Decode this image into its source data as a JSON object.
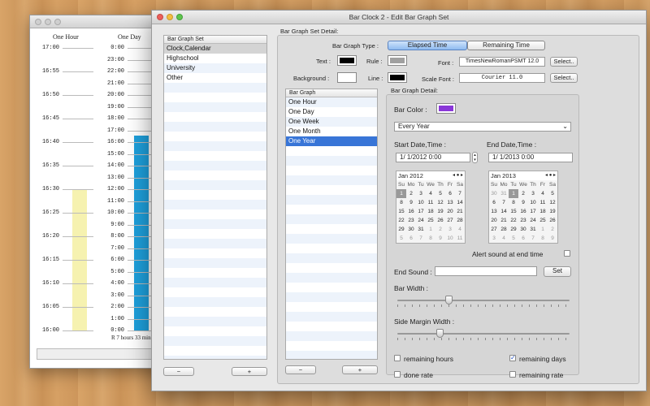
{
  "bg_window": {
    "columns": [
      "One Hour",
      "One Day"
    ],
    "hour_ticks": [
      "17:00",
      "16:55",
      "16:50",
      "16:45",
      "16:40",
      "16:35",
      "16:30",
      "16:25",
      "16:20",
      "16:15",
      "16:10",
      "16:05",
      "16:00"
    ],
    "day_ticks": [
      "0:00",
      "23:00",
      "22:00",
      "21:00",
      "20:00",
      "19:00",
      "18:00",
      "17:00",
      "16:00",
      "15:00",
      "14:00",
      "13:00",
      "12:00",
      "11:00",
      "10:00",
      "9:00",
      "8:00",
      "7:00",
      "6:00",
      "5:00",
      "4:00",
      "3:00",
      "2:00",
      "1:00",
      "0:00"
    ],
    "remaining_label": "R 7 hours 33 min",
    "hour_bar_fill": 0.5,
    "day_bar_fill": 0.69,
    "colors": {
      "hour_bar": "#f6f2b0",
      "day_bar": "#1ea0dc"
    }
  },
  "main": {
    "title": "Bar Clock 2 - Edit Bar Graph Set",
    "set_list": {
      "header": "Bar Graph Set",
      "items": [
        "Clock,Calendar",
        "Highschool",
        "University",
        "Other"
      ],
      "selected": 0
    },
    "set_detail_label": "Bar Graph Set Detail:",
    "type_label": "Bar Graph Type :",
    "type_options": [
      "Elapsed Time",
      "Remaining Time"
    ],
    "text_label": "Text :",
    "rule_label": "Rule :",
    "background_label": "Background :",
    "line_label": "Line :",
    "font_label": "Font :",
    "font_value": "TimesNewRomanPSMT 12.0",
    "scale_font_label": "Scale Font :",
    "scale_font_value": "Courier 11.0",
    "select_label": "Select..",
    "colors": {
      "text": "#000000",
      "rule": "#a0a0a0",
      "background": "#ffffff",
      "line": "#000000",
      "bar": "#8a38d8"
    },
    "graph_list": {
      "header": "Bar Graph",
      "items": [
        "One Hour",
        "One Day",
        "One Week",
        "One Month",
        "One Year"
      ],
      "selected": 4
    },
    "detail_label": "Bar Graph Detail:",
    "bar_color_label": "Bar Color :",
    "period": "Every Year",
    "start_label": "Start Date,Time :",
    "start_value": "1/  1/2012   0:00",
    "end_label": "End Date,Time :",
    "end_value": "1/  1/2013   0:00",
    "weekdays": [
      "Su",
      "Mo",
      "Tu",
      "We",
      "Th",
      "Fr",
      "Sa"
    ],
    "cal1": {
      "title": "Jan 2012",
      "nav": "◂ ● ▸",
      "weeks": [
        [
          "1",
          "2",
          "3",
          "4",
          "5",
          "6",
          "7"
        ],
        [
          "8",
          "9",
          "10",
          "11",
          "12",
          "13",
          "14"
        ],
        [
          "15",
          "16",
          "17",
          "18",
          "19",
          "20",
          "21"
        ],
        [
          "22",
          "23",
          "24",
          "25",
          "26",
          "27",
          "28"
        ],
        [
          "29",
          "30",
          "31",
          "1",
          "2",
          "3",
          "4"
        ],
        [
          "5",
          "6",
          "7",
          "8",
          "9",
          "10",
          "11"
        ]
      ]
    },
    "cal2": {
      "title": "Jan 2013",
      "nav": "◂ ● ▸",
      "weeks": [
        [
          "30",
          "31",
          "1",
          "2",
          "3",
          "4",
          "5"
        ],
        [
          "6",
          "7",
          "8",
          "9",
          "10",
          "11",
          "12"
        ],
        [
          "13",
          "14",
          "15",
          "16",
          "17",
          "18",
          "19"
        ],
        [
          "20",
          "21",
          "22",
          "23",
          "24",
          "25",
          "26"
        ],
        [
          "27",
          "28",
          "29",
          "30",
          "31",
          "1",
          "2"
        ],
        [
          "3",
          "4",
          "5",
          "6",
          "7",
          "8",
          "9"
        ]
      ]
    },
    "alert_label": "Alert sound at end time",
    "end_sound_label": "End Sound :",
    "set_label": "Set",
    "bar_width_label": "Bar Width :",
    "bar_width_value": 0.3,
    "side_margin_label": "Side Margin Width :",
    "side_margin_value": 0.25,
    "checks": [
      {
        "label": "remaining hours",
        "checked": false
      },
      {
        "label": "remaining days",
        "checked": true
      },
      {
        "label": "done rate",
        "checked": false
      },
      {
        "label": "remaining rate",
        "checked": false
      }
    ],
    "minus": "−",
    "plus": "+"
  }
}
